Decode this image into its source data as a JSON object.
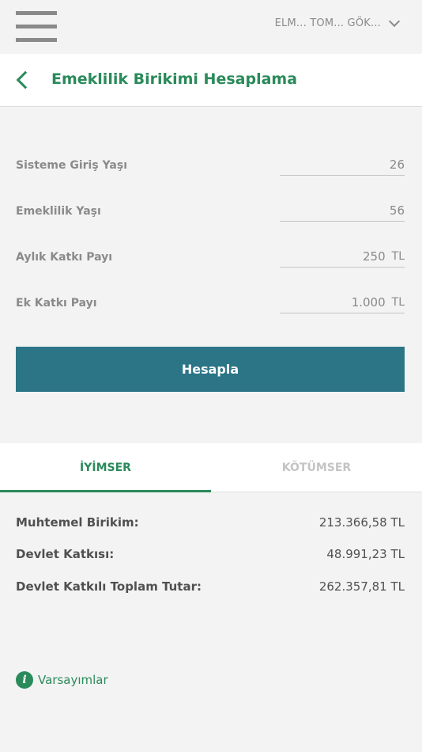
{
  "header": {
    "user_label": "ELM... TOM... GÖK..."
  },
  "page": {
    "title": "Emeklilik Birikimi Hesaplama"
  },
  "form": {
    "fields": [
      {
        "label": "Sisteme Giriş Yaşı",
        "value": "26",
        "unit": ""
      },
      {
        "label": "Emeklilik Yaşı",
        "value": "56",
        "unit": ""
      },
      {
        "label": "Aylık Katkı Payı",
        "value": "250",
        "unit": "TL"
      },
      {
        "label": "Ek Katkı Payı",
        "value": "1.000",
        "unit": "TL"
      }
    ],
    "submit_label": "Hesapla"
  },
  "tabs": [
    {
      "label": "İYİMSER",
      "active": true
    },
    {
      "label": "KÖTÜMSER",
      "active": false
    }
  ],
  "results": [
    {
      "label": "Muhtemel Birikim:",
      "value": "213.366,58 TL"
    },
    {
      "label": "Devlet Katkısı:",
      "value": "48.991,23 TL"
    },
    {
      "label": "Devlet Katkılı Toplam Tutar:",
      "value": "262.357,81 TL"
    }
  ],
  "footer": {
    "info_link": "Varsayımlar",
    "info_icon_glyph": "i"
  },
  "colors": {
    "accent_green": "#2a8a5a",
    "button_teal": "#2c7587"
  }
}
